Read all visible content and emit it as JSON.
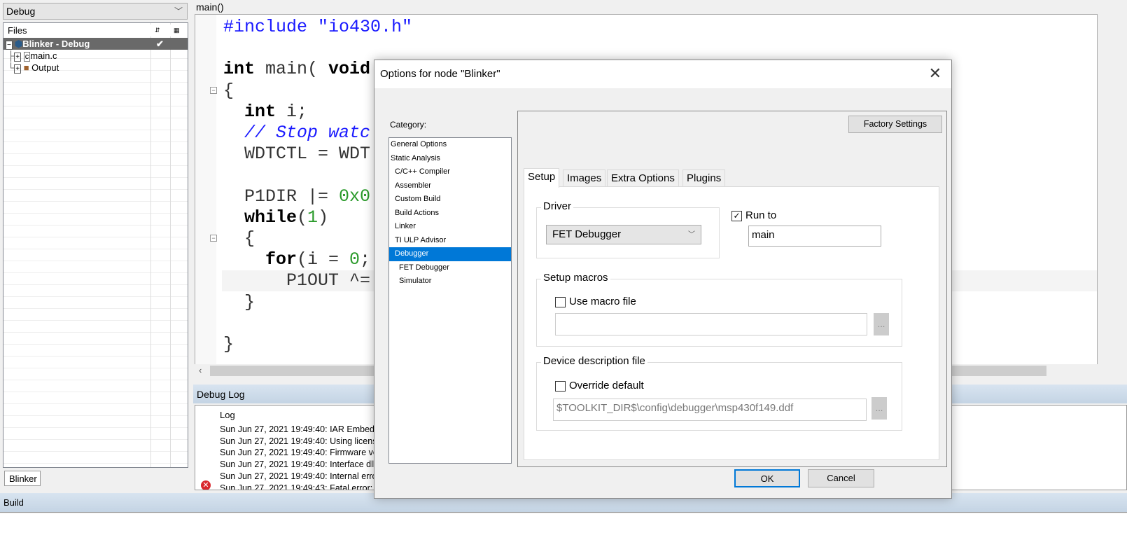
{
  "workspace": {
    "config": "Debug",
    "files_header": "Files",
    "project": "Blinker - Debug",
    "project_check": "✔",
    "items": [
      "main.c",
      "Output"
    ],
    "tab": "Blinker"
  },
  "editor": {
    "title": "main()",
    "lines": [
      [
        {
          "t": "#include \"io430.h\"",
          "c": "pp"
        }
      ],
      [],
      [
        {
          "t": "int",
          "c": "kw"
        },
        {
          "t": " main( "
        },
        {
          "t": "void",
          "c": "kw"
        }
      ],
      [
        {
          "t": "{"
        }
      ],
      [
        {
          "t": "  "
        },
        {
          "t": "int",
          "c": "kw"
        },
        {
          "t": " i;"
        }
      ],
      [
        {
          "t": "  // Stop watc",
          "c": "cm"
        }
      ],
      [
        {
          "t": "  WDTCTL = WDT"
        }
      ],
      [],
      [
        {
          "t": "  P1DIR |= "
        },
        {
          "t": "0x0",
          "c": "num"
        }
      ],
      [
        {
          "t": "  "
        },
        {
          "t": "while",
          "c": "kw"
        },
        {
          "t": "("
        },
        {
          "t": "1",
          "c": "num"
        },
        {
          "t": ")"
        }
      ],
      [
        {
          "t": "  {"
        }
      ],
      [
        {
          "t": "    "
        },
        {
          "t": "for",
          "c": "kw"
        },
        {
          "t": "(i = "
        },
        {
          "t": "0",
          "c": "num"
        },
        {
          "t": ";"
        }
      ],
      [
        {
          "t": "      P1OUT ^="
        }
      ],
      [
        {
          "t": "  }"
        }
      ],
      [],
      [
        {
          "t": "}"
        }
      ]
    ]
  },
  "debug_log": {
    "title": "Debug Log",
    "header": "Log",
    "entries": [
      "Sun Jun 27, 2021 19:49:40: IAR Embedd",
      "Sun Jun 27, 2021 19:49:40: Using licens",
      "Sun Jun 27, 2021 19:49:40: Firmware ve",
      "Sun Jun 27, 2021 19:49:40: Interface dll",
      "Sun Jun 27, 2021 19:49:40: Internal erro",
      "Sun Jun 27, 2021 19:49:43: Fatal error: "
    ]
  },
  "build": {
    "title": "Build"
  },
  "dialog": {
    "title": "Options for node \"Blinker\"",
    "category_label": "Category:",
    "categories": [
      "General Options",
      "Static Analysis",
      "C/C++ Compiler",
      "Assembler",
      "Custom Build",
      "Build Actions",
      "Linker",
      "TI ULP Advisor",
      "Debugger",
      "FET Debugger",
      "Simulator"
    ],
    "selected_category": "Debugger",
    "factory_settings": "Factory Settings",
    "tabs": [
      "Setup",
      "Images",
      "Extra Options",
      "Plugins"
    ],
    "active_tab": "Setup",
    "driver": {
      "label": "Driver",
      "value": "FET Debugger"
    },
    "run_to": {
      "label": "Run to",
      "checked": true,
      "value": "main"
    },
    "setup_macros": {
      "label": "Setup macros",
      "use_macro_label": "Use macro file",
      "checked": false,
      "value": "",
      "browse": "..."
    },
    "device_file": {
      "label": "Device description file",
      "override_label": "Override default",
      "checked": false,
      "value": "$TOOLKIT_DIR$\\config\\debugger\\msp430f149.ddf",
      "browse": "..."
    },
    "ok": "OK",
    "cancel": "Cancel"
  },
  "colors": {
    "selection": "#0078d7",
    "panel_header": "#c4d4e4"
  }
}
